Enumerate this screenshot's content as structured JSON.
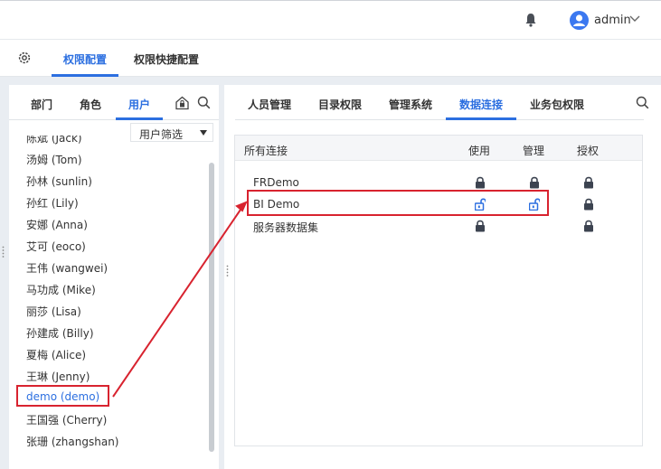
{
  "header": {
    "user_name": "admin"
  },
  "main_tabs": [
    {
      "label": "权限配置",
      "active": true
    },
    {
      "label": "权限快捷配置",
      "active": false
    }
  ],
  "left_tabs": [
    {
      "label": "部门"
    },
    {
      "label": "角色"
    },
    {
      "label": "用户",
      "active": true
    }
  ],
  "filter": {
    "label": "用户筛选"
  },
  "users": [
    "陈斌 (Jack)",
    "汤姆 (Tom)",
    "孙林 (sunlin)",
    "孙红 (Lily)",
    "安娜 (Anna)",
    "艾可 (eoco)",
    "王伟 (wangwei)",
    "马功成 (Mike)",
    "丽莎 (Lisa)",
    "孙建成 (Billy)",
    "夏梅 (Alice)",
    "王琳 (Jenny)",
    "demo (demo)",
    "王国强 (Cherry)",
    "张珊 (zhangshan)"
  ],
  "selected_user": "demo (demo)",
  "right_tabs": [
    {
      "label": "人员管理"
    },
    {
      "label": "目录权限"
    },
    {
      "label": "管理系统"
    },
    {
      "label": "数据连接",
      "active": true
    },
    {
      "label": "业务包权限"
    }
  ],
  "table": {
    "headers": {
      "name": "所有连接",
      "use": "使用",
      "manage": "管理",
      "grant": "授权"
    },
    "rows": [
      {
        "name": "FRDemo",
        "use": "locked",
        "manage": "locked",
        "grant": "locked"
      },
      {
        "name": "BI Demo",
        "use": "unlocked",
        "manage": "unlocked",
        "grant": "locked"
      },
      {
        "name": "服务器数据集",
        "use": "locked",
        "manage": "",
        "grant": "locked"
      }
    ]
  },
  "colors": {
    "accent": "#2c6fe0",
    "highlight": "#d8232f",
    "locked": "#3c4350",
    "unlocked": "#2c6fe0"
  }
}
